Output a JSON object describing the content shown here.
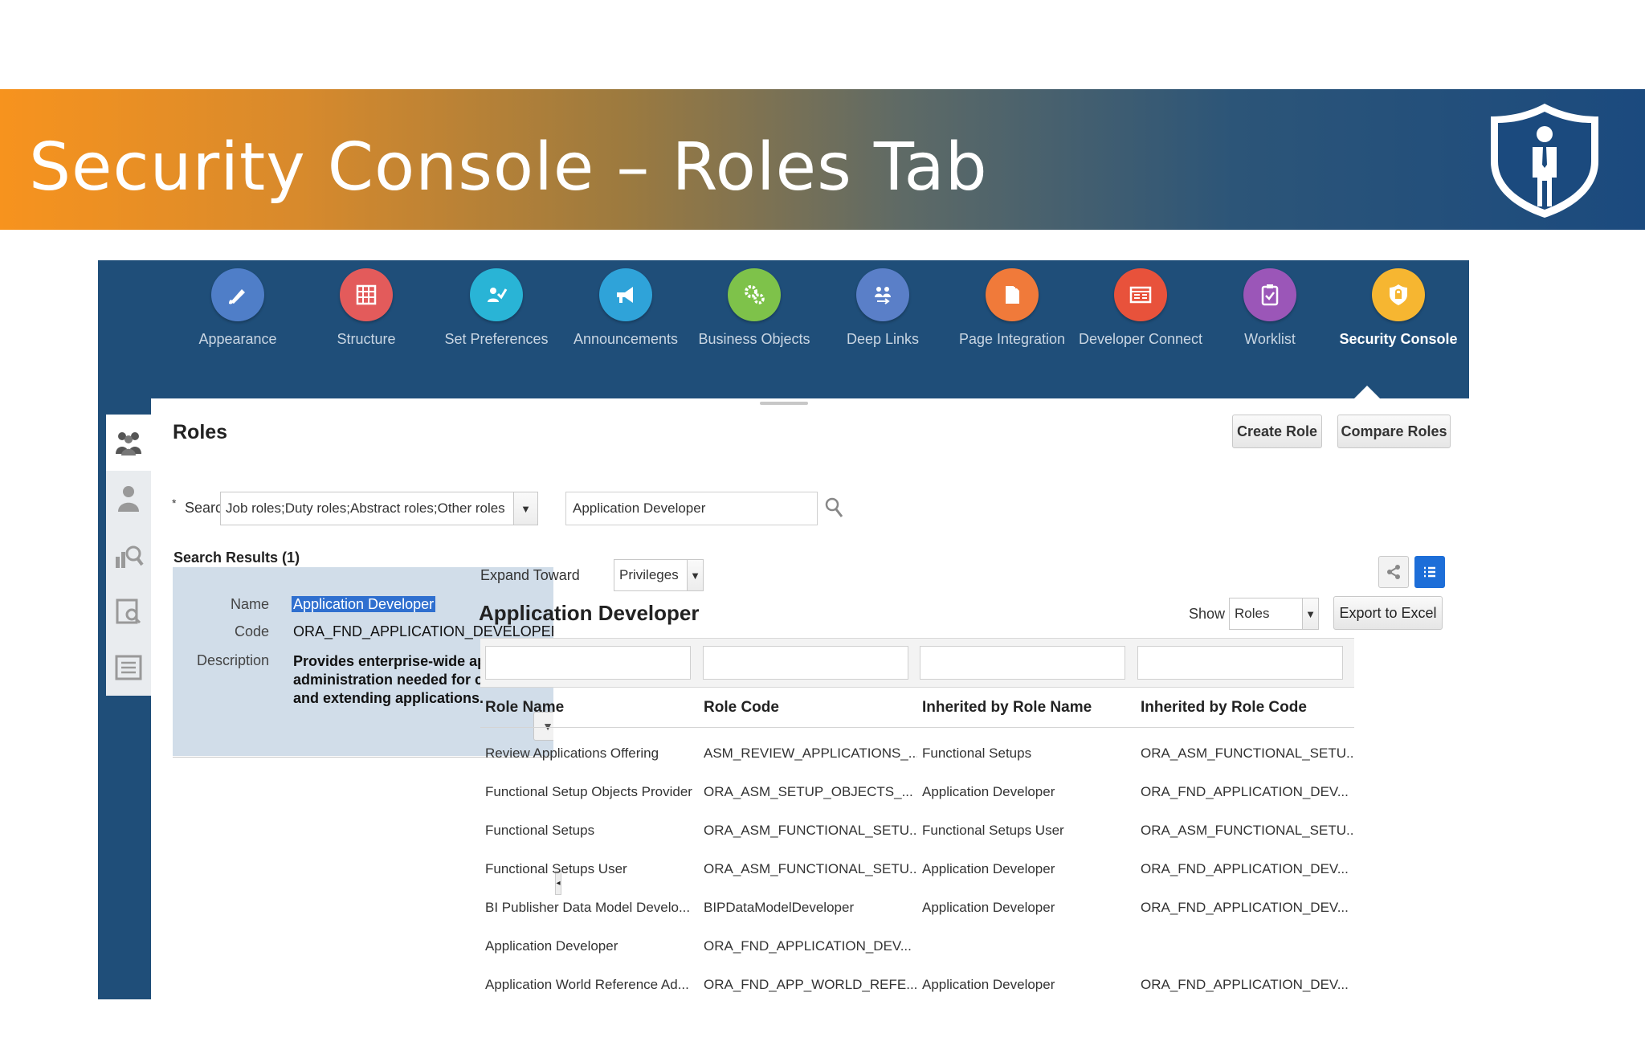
{
  "slide": {
    "title": "Security Console – Roles Tab"
  },
  "toolbar": {
    "tools": [
      {
        "label": "Appearance",
        "color": "#4f7ec8"
      },
      {
        "label": "Structure",
        "color": "#e35b5b"
      },
      {
        "label": "Set Preferences",
        "color": "#29b4d6"
      },
      {
        "label": "Announcements",
        "color": "#2fa3d9"
      },
      {
        "label": "Business Objects",
        "color": "#7ec24a"
      },
      {
        "label": "Deep Links",
        "color": "#5a7fc8"
      },
      {
        "label": "Page Integration",
        "color": "#f07a3a"
      },
      {
        "label": "Developer Connect",
        "color": "#e8523b"
      },
      {
        "label": "Worklist",
        "color": "#9b56b8"
      },
      {
        "label": "Security Console",
        "color": "#f6b631",
        "active": true
      }
    ]
  },
  "roles_panel": {
    "title": "Roles",
    "create_role": "Create Role",
    "compare_roles": "Compare Roles",
    "search": {
      "required_marker": "*",
      "label": "Search",
      "scope_value": "Job roles;Duty roles;Abstract roles;Other roles",
      "query_value": "Application Developer"
    },
    "results": {
      "heading": "Search Results (1)",
      "name_label": "Name",
      "name_value": "Application Developer",
      "code_label": "Code",
      "code_value": "ORA_FND_APPLICATION_DEVELOPER_JOB",
      "description_label": "Description",
      "description_value": "Provides enterprise-wide application administration needed for customizing and extending applications."
    }
  },
  "detail": {
    "expand_toward_label": "Expand Toward",
    "expand_toward_value": "Privileges",
    "title": "Application Developer",
    "show_label": "Show",
    "show_value": "Roles",
    "export_label": "Export to Excel",
    "columns": [
      "Role Name",
      "Role Code",
      "Inherited by Role Name",
      "Inherited by Role Code"
    ],
    "rows": [
      [
        "Review Applications Offering",
        "ASM_REVIEW_APPLICATIONS_...",
        "Functional Setups",
        "ORA_ASM_FUNCTIONAL_SETU..."
      ],
      [
        "Functional Setup Objects Provider",
        "ORA_ASM_SETUP_OBJECTS_...",
        "Application Developer",
        "ORA_FND_APPLICATION_DEV..."
      ],
      [
        "Functional Setups",
        "ORA_ASM_FUNCTIONAL_SETU...",
        "Functional Setups User",
        "ORA_ASM_FUNCTIONAL_SETU..."
      ],
      [
        "Functional Setups User",
        "ORA_ASM_FUNCTIONAL_SETU...",
        "Application Developer",
        "ORA_FND_APPLICATION_DEV..."
      ],
      [
        "BI Publisher Data Model Develo...",
        "BIPDataModelDeveloper",
        "Application Developer",
        "ORA_FND_APPLICATION_DEV..."
      ],
      [
        "Application Developer",
        "ORA_FND_APPLICATION_DEV...",
        "",
        ""
      ],
      [
        "Application World Reference Ad...",
        "ORA_FND_APP_WORLD_REFE...",
        "Application Developer",
        "ORA_FND_APPLICATION_DEV..."
      ]
    ]
  }
}
